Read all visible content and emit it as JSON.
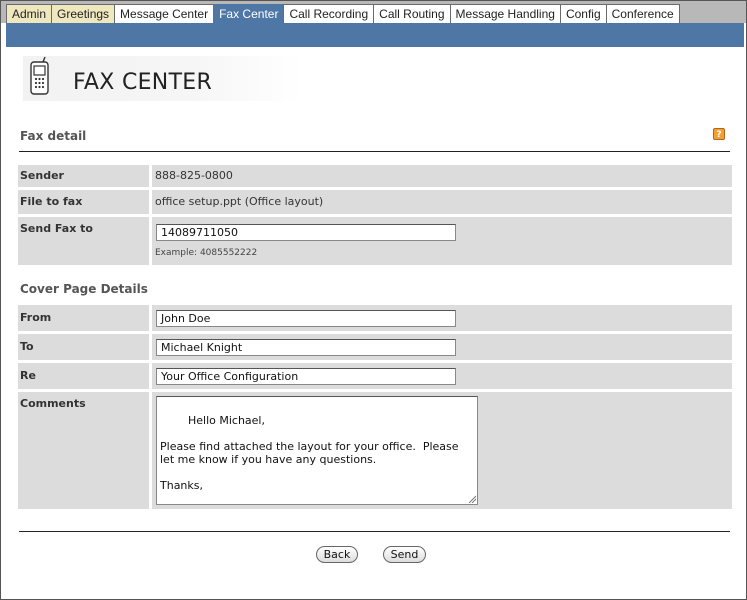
{
  "tabs": [
    {
      "label": "Admin"
    },
    {
      "label": "Greetings"
    },
    {
      "label": "Message Center"
    },
    {
      "label": "Fax Center"
    },
    {
      "label": "Call Recording"
    },
    {
      "label": "Call Routing"
    },
    {
      "label": "Message Handling"
    },
    {
      "label": "Config"
    },
    {
      "label": "Conference"
    }
  ],
  "active_tab": "Fax Center",
  "page_title": "FAX CENTER",
  "fax_detail": {
    "section_title": "Fax detail",
    "sender_label": "Sender",
    "sender_value": "888-825-0800",
    "file_label": "File to fax",
    "file_value": "office setup.ppt (Office layout)",
    "send_to_label": "Send Fax to",
    "send_to_value": "14089711050",
    "send_to_hint": "Example: 4085552222"
  },
  "cover_page": {
    "section_title": "Cover Page Details",
    "from_label": "From",
    "from_value": "John Doe",
    "to_label": "To",
    "to_value": "Michael Knight",
    "re_label": "Re",
    "re_value": "Your Office Configuration",
    "comments_label": "Comments",
    "comments_value": "Hello Michael,\n\nPlease find attached the layout for your office.  Please let me know if you have any questions.\n\nThanks,\n\nJohn"
  },
  "buttons": {
    "back": "Back",
    "send": "Send"
  },
  "colors": {
    "tab_bar": "#b8b8b8",
    "active_tab": "#4f77a6",
    "row_background": "#dcdcdc",
    "beige_tab": "#efe8be"
  },
  "icons": [
    "fax-phone-icon",
    "help-icon",
    "resize-grip-icon"
  ]
}
